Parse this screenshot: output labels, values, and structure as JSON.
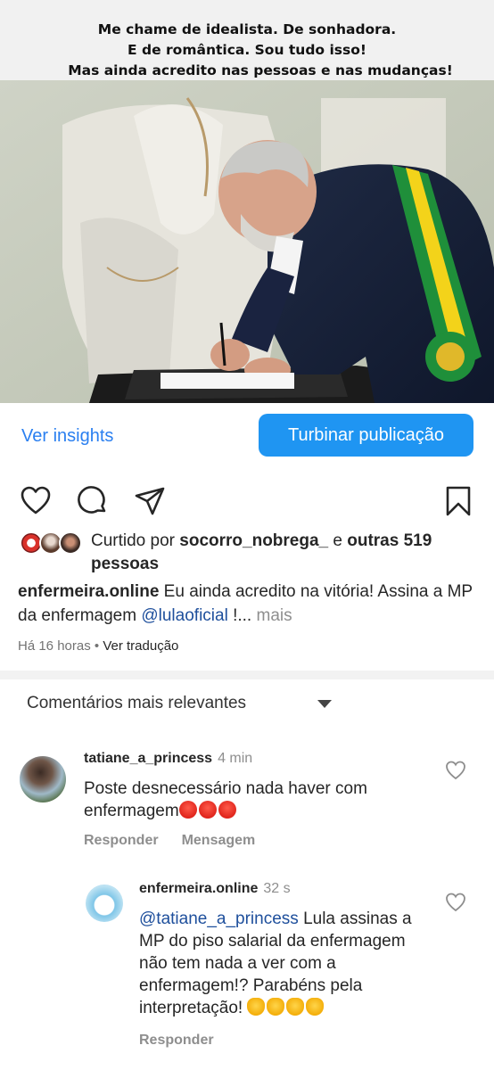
{
  "post_image": {
    "caption_lines": [
      "Me chame de idealista. De sonhadora.",
      "E de romântica. Sou tudo isso!",
      "Mas ainda acredito nas pessoas e nas mudanças!"
    ]
  },
  "actions": {
    "insights_label": "Ver insights",
    "boost_label": "Turbinar publicação",
    "icons": [
      "heart-icon",
      "comment-icon",
      "share-icon",
      "bookmark-icon"
    ]
  },
  "likes": {
    "prefix": "Curtido por",
    "user": "socorro_nobrega_",
    "connector": "e",
    "others": "outras 519 pessoas"
  },
  "caption": {
    "username": "enfermeira.online",
    "text": "Eu ainda acredito na vitória! Assina a MP da enfermagem",
    "mention": "@lulaoficial",
    "suffix": "!...",
    "more": "mais",
    "time": "Há 16 horas",
    "separator": "•",
    "translate": "Ver tradução"
  },
  "comments_header": {
    "label": "Comentários mais relevantes"
  },
  "comments": [
    {
      "username": "tatiane_a_princess",
      "time": "4 min",
      "text": "Poste  desnecessário nada haver com enfermagem",
      "reply_label": "Responder",
      "message_label": "Mensagem"
    },
    {
      "username": "enfermeira.online",
      "time": "32 s",
      "mention": "@tatiane_a_princess",
      "text": "Lula assinas a MP do piso salarial da enfermagem não tem nada a ver com a enfermagem!? Parabéns pela interpretação!",
      "reply_label": "Responder"
    }
  ],
  "colors": {
    "link_blue": "#2a7ff0",
    "button_blue": "#1f95f2",
    "mention_blue": "#1e4f9c",
    "muted_gray": "#8e8e8e"
  }
}
